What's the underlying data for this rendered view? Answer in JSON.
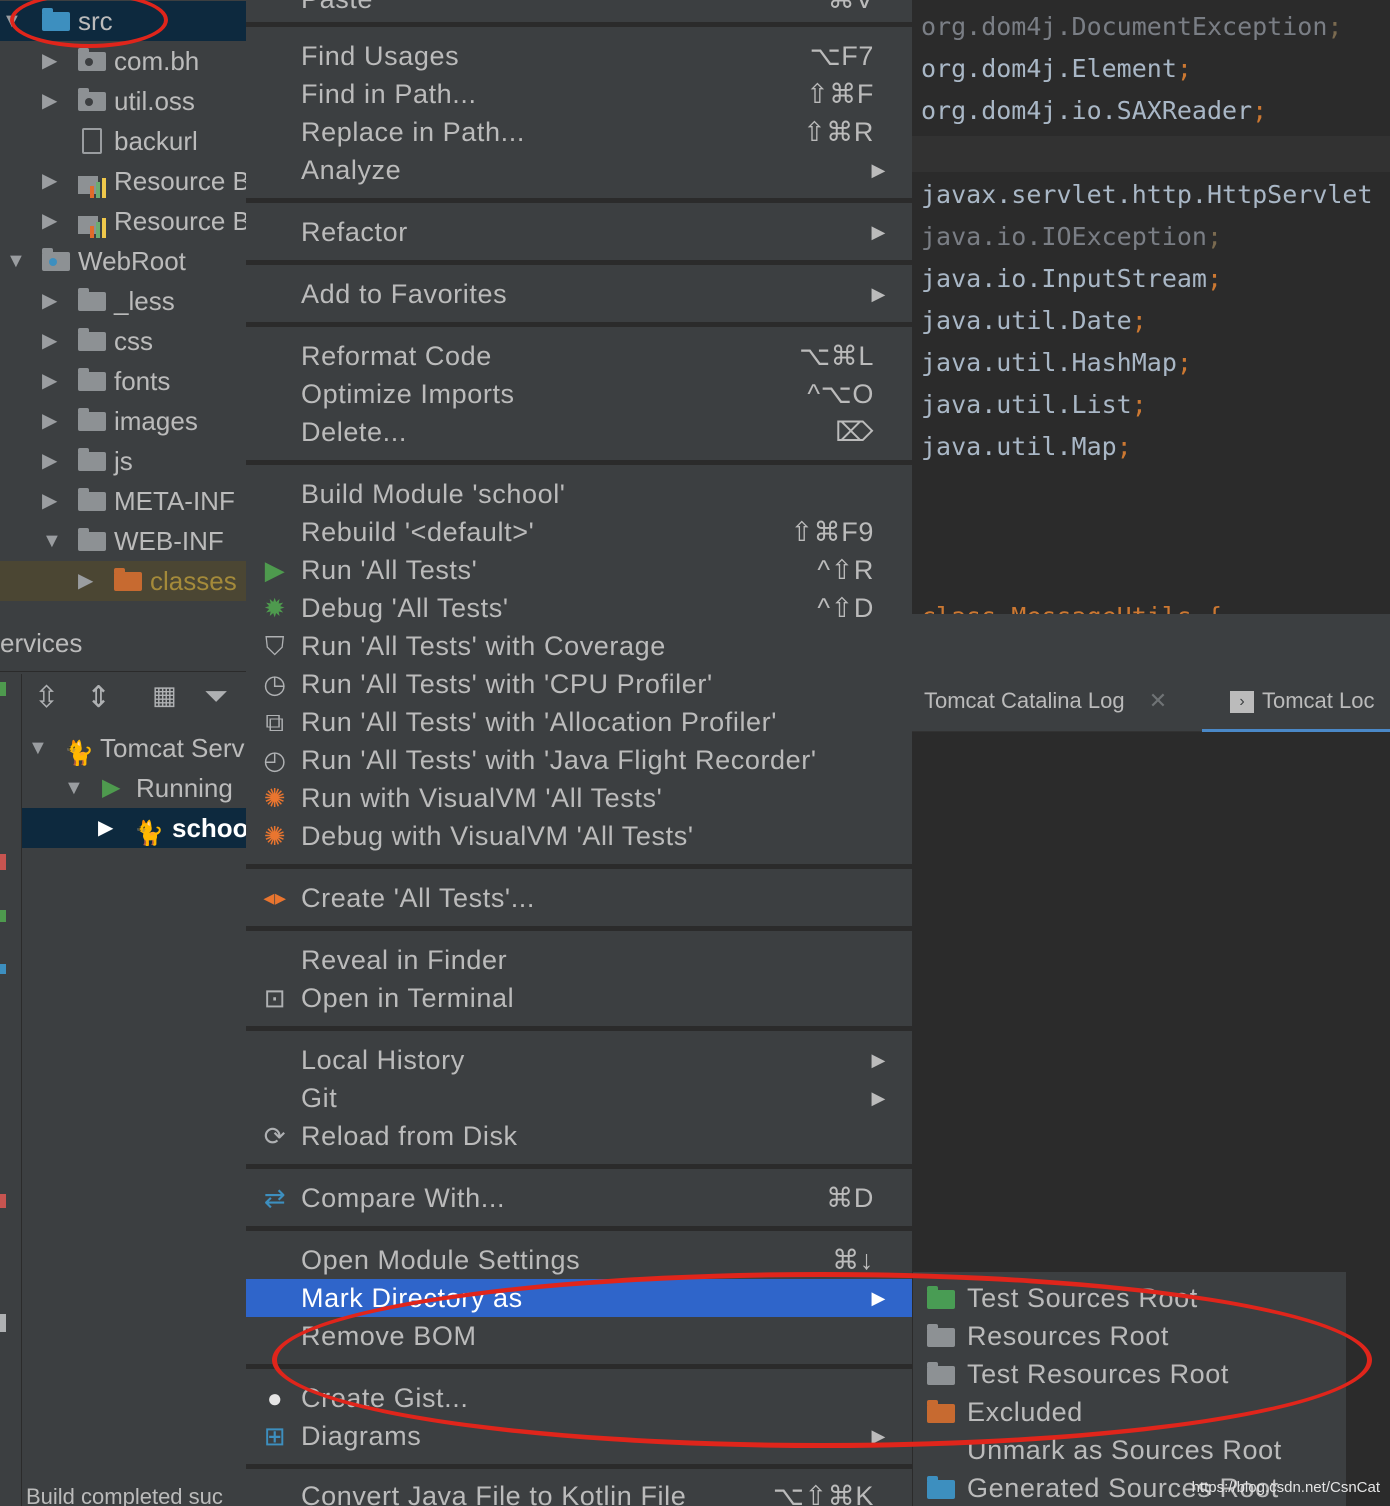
{
  "project_tree": {
    "items": [
      {
        "label": "src",
        "icon": "folder-source-icon"
      },
      {
        "label": "com.bh",
        "icon": "package-icon"
      },
      {
        "label": "util.oss",
        "icon": "package-icon"
      },
      {
        "label": "backurl",
        "icon": "file-icon"
      },
      {
        "label": "Resource B",
        "icon": "resource-bundle-icon"
      },
      {
        "label": "Resource B",
        "icon": "resource-bundle-icon"
      },
      {
        "label": "WebRoot",
        "icon": "web-folder-icon"
      },
      {
        "label": "_less",
        "icon": "folder-icon"
      },
      {
        "label": "css",
        "icon": "folder-icon"
      },
      {
        "label": "fonts",
        "icon": "folder-icon"
      },
      {
        "label": "images",
        "icon": "folder-icon"
      },
      {
        "label": "js",
        "icon": "folder-icon"
      },
      {
        "label": "META-INF",
        "icon": "folder-icon"
      },
      {
        "label": "WEB-INF",
        "icon": "folder-icon"
      },
      {
        "label": "classes",
        "icon": "folder-excluded-icon"
      }
    ]
  },
  "services": {
    "title": "ervices",
    "tree": [
      {
        "label": "Tomcat Serv"
      },
      {
        "label": "Running"
      },
      {
        "label": "schoo"
      }
    ],
    "status": "Build completed suc"
  },
  "editor": {
    "lines": [
      {
        "text": "org.dom4j.DocumentException",
        "semi": ";",
        "muted": true
      },
      {
        "text": "org.dom4j.Element",
        "semi": ";",
        "muted": false
      },
      {
        "text": "org.dom4j.io.SAXReader",
        "semi": ";",
        "muted": false
      },
      {
        "text": "javax.servlet.http.HttpServlet",
        "semi": "",
        "muted": false
      },
      {
        "text": "java.io.IOException",
        "semi": ";",
        "muted": true
      },
      {
        "text": "java.io.InputStream",
        "semi": ";",
        "muted": false
      },
      {
        "text": "java.util.Date",
        "semi": ";",
        "muted": false
      },
      {
        "text": "java.util.HashMap",
        "semi": ";",
        "muted": false
      },
      {
        "text": "java.util.List",
        "semi": ";",
        "muted": false
      },
      {
        "text": "java.util.Map",
        "semi": ";",
        "muted": false
      },
      {
        "text": "class MessageUtils {",
        "semi": "",
        "muted": false
      }
    ]
  },
  "bottom_tabs": [
    {
      "label": "Tomcat Catalina Log"
    },
    {
      "label": "Tomcat Loc"
    }
  ],
  "menu": {
    "paste": {
      "label": "Paste",
      "shortcut": "⌘V"
    },
    "items": {
      "find_usages": {
        "label": "Find Usages",
        "shortcut": "⌥F7"
      },
      "find_in_path": {
        "label": "Find in Path...",
        "shortcut": "⇧⌘F"
      },
      "replace_in_path": {
        "label": "Replace in Path...",
        "shortcut": "⇧⌘R"
      },
      "analyze": {
        "label": "Analyze"
      },
      "refactor": {
        "label": "Refactor"
      },
      "add_to_favorites": {
        "label": "Add to Favorites"
      },
      "reformat_code": {
        "label": "Reformat Code",
        "shortcut": "⌥⌘L"
      },
      "optimize_imports": {
        "label": "Optimize Imports",
        "shortcut": "^⌥O"
      },
      "delete": {
        "label": "Delete...",
        "shortcut": "⌦"
      },
      "build_module": {
        "label": "Build Module 'school'"
      },
      "rebuild": {
        "label": "Rebuild '<default>'",
        "shortcut": "⇧⌘F9"
      },
      "run_all_tests": {
        "label": "Run 'All Tests'",
        "shortcut": "^⇧R"
      },
      "debug_all_tests": {
        "label": "Debug 'All Tests'",
        "shortcut": "^⇧D"
      },
      "run_with_coverage": {
        "label": "Run 'All Tests' with Coverage"
      },
      "run_cpu_profiler": {
        "label": "Run 'All Tests' with 'CPU Profiler'"
      },
      "run_alloc_profiler": {
        "label": "Run 'All Tests' with 'Allocation Profiler'"
      },
      "run_jfr": {
        "label": "Run 'All Tests' with 'Java Flight Recorder'"
      },
      "run_visualvm": {
        "label": "Run with VisualVM 'All Tests'"
      },
      "debug_visualvm": {
        "label": "Debug with VisualVM 'All Tests'"
      },
      "create_all_tests": {
        "label": "Create 'All Tests'..."
      },
      "reveal_in_finder": {
        "label": "Reveal in Finder"
      },
      "open_in_terminal": {
        "label": "Open in Terminal"
      },
      "local_history": {
        "label": "Local History"
      },
      "git": {
        "label": "Git"
      },
      "reload_from_disk": {
        "label": "Reload from Disk"
      },
      "compare_with": {
        "label": "Compare With...",
        "shortcut": "⌘D"
      },
      "open_module_settings": {
        "label": "Open Module Settings",
        "shortcut": "⌘↓"
      },
      "mark_directory_as": {
        "label": "Mark Directory as"
      },
      "remove_bom": {
        "label": "Remove BOM"
      },
      "create_gist": {
        "label": "Create Gist..."
      },
      "diagrams": {
        "label": "Diagrams"
      },
      "convert_kotlin": {
        "label": "Convert Java File to Kotlin File",
        "shortcut": "⌥⇧⌘K"
      }
    }
  },
  "submenu": {
    "items": [
      {
        "label": "Test Sources Root",
        "color": "#499c54"
      },
      {
        "label": "Resources Root",
        "color": "#8d9194"
      },
      {
        "label": "Test Resources Root",
        "color": "#8d9194"
      },
      {
        "label": "Excluded",
        "color": "#c76a30"
      },
      {
        "label": "Unmark as Sources Root",
        "color": ""
      },
      {
        "label": "Generated Sources Root",
        "color": "#3d8fbf"
      }
    ]
  },
  "watermark": "https://blog.csdn.net/CsnCat",
  "colors": {
    "menu_bg": "#3c3f41",
    "selection": "#2f65ca",
    "annotation_red": "#e0251b",
    "keyword_orange": "#cc7832"
  }
}
